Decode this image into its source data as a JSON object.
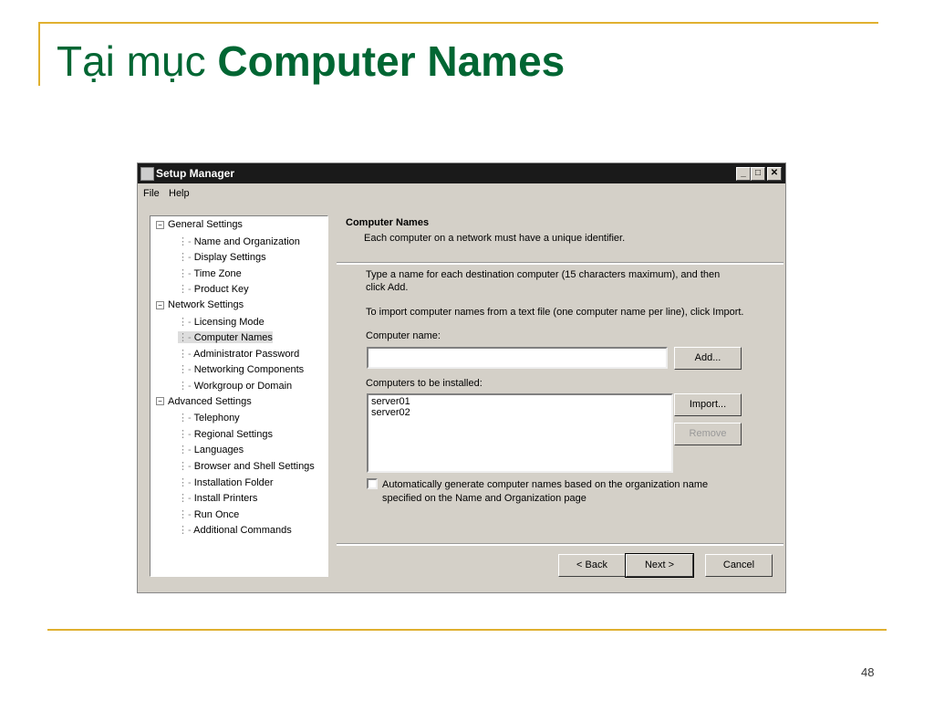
{
  "slide": {
    "title_prefix": "Tại mục",
    "title_bold": "Computer Names",
    "page_number": "48"
  },
  "window": {
    "title": "Setup Manager",
    "menu": [
      "File",
      "Help"
    ],
    "tree": [
      {
        "label": "General Settings",
        "level": 0
      },
      {
        "label": "Name and Organization",
        "level": 1
      },
      {
        "label": "Display Settings",
        "level": 1
      },
      {
        "label": "Time Zone",
        "level": 1
      },
      {
        "label": "Product Key",
        "level": 1
      },
      {
        "label": "Network Settings",
        "level": 0
      },
      {
        "label": "Licensing Mode",
        "level": 1
      },
      {
        "label": "Computer Names",
        "level": 1,
        "selected": true
      },
      {
        "label": "Administrator Password",
        "level": 1
      },
      {
        "label": "Networking Components",
        "level": 1
      },
      {
        "label": "Workgroup or Domain",
        "level": 1
      },
      {
        "label": "Advanced Settings",
        "level": 0
      },
      {
        "label": "Telephony",
        "level": 1
      },
      {
        "label": "Regional Settings",
        "level": 1
      },
      {
        "label": "Languages",
        "level": 1
      },
      {
        "label": "Browser and Shell Settings",
        "level": 1
      },
      {
        "label": "Installation Folder",
        "level": 1
      },
      {
        "label": "Install Printers",
        "level": 1
      },
      {
        "label": "Run Once",
        "level": 1
      },
      {
        "label": "Additional Commands",
        "level": 1
      }
    ],
    "page": {
      "heading": "Computer Names",
      "subheading": "Each computer on a network must have a unique identifier.",
      "instr1": "Type a name for each destination computer (15 characters maximum), and then click Add.",
      "instr2": "To import computer names from a text file (one computer name per line), click Import.",
      "name_label": "Computer name:",
      "name_value": "",
      "list_label": "Computers to be installed:",
      "list_items": [
        "server01",
        "server02"
      ],
      "add": "Add...",
      "import": "Import...",
      "remove": "Remove",
      "auto_label": "Automatically generate computer names based on the organization name specified on the Name and Organization page",
      "back": "< Back",
      "next": "Next >",
      "cancel": "Cancel"
    }
  }
}
